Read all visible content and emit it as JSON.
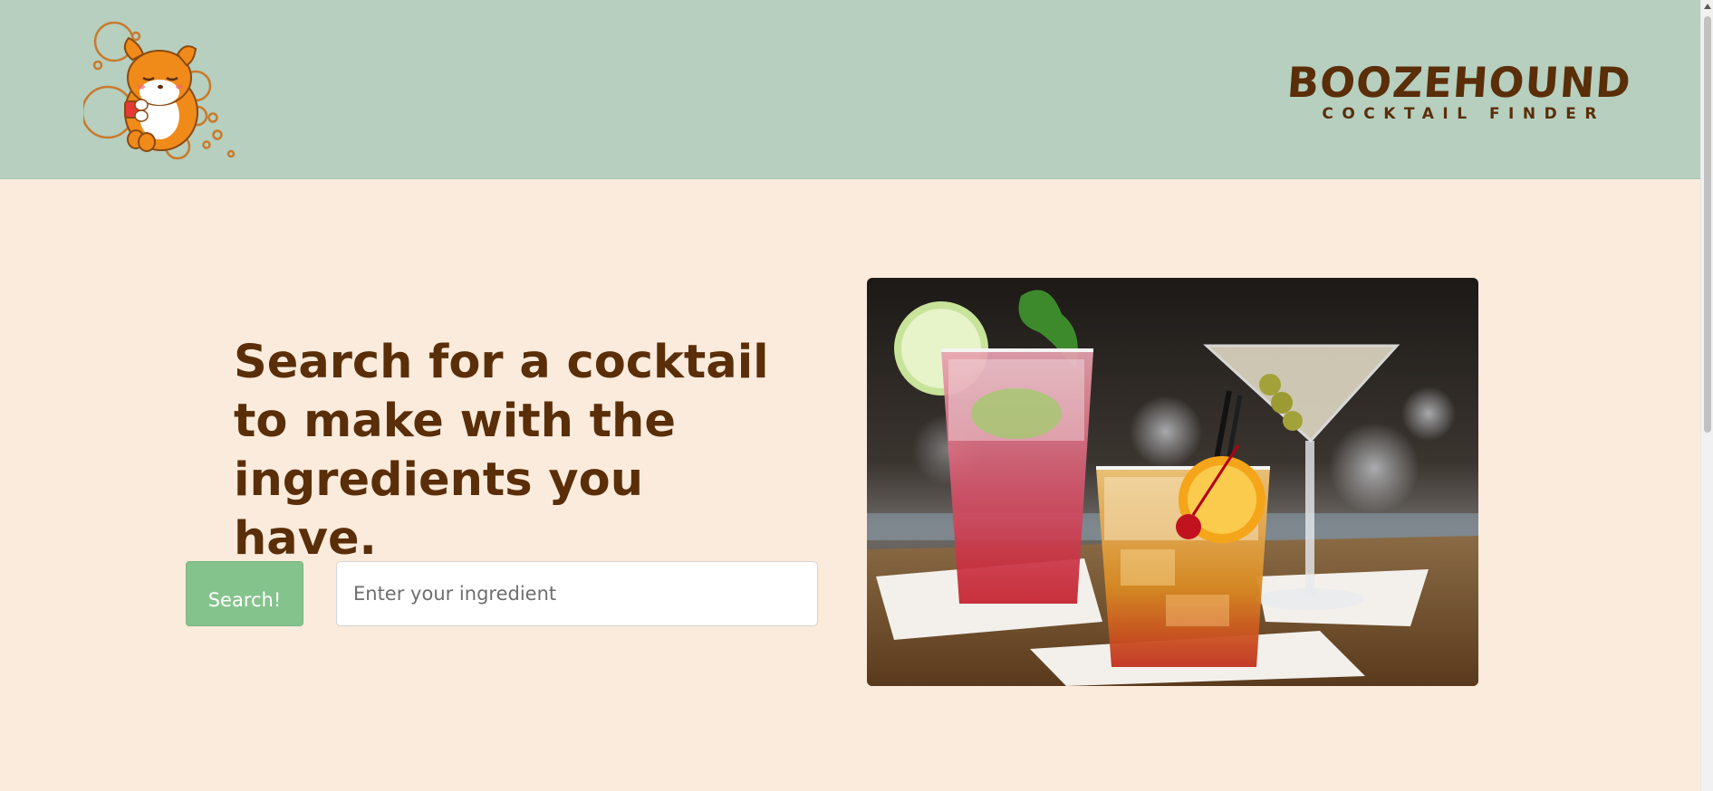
{
  "header": {
    "brand_title": "BOOZEHOUND",
    "brand_subtitle": "COCKTAIL FINDER",
    "logo_icon": "puppy-with-drink-icon"
  },
  "hero": {
    "headline": "Search for a cocktail to make with the ingredients you have.",
    "search_button_label": "Search!",
    "search_placeholder": "Enter your ingredient",
    "search_value": "",
    "image_icon": "cocktails-photo"
  },
  "colors": {
    "header_bg": "#b6cfbf",
    "page_bg": "#faebdc",
    "brand_brown": "#5a2e08",
    "button_green": "#85c38d"
  }
}
